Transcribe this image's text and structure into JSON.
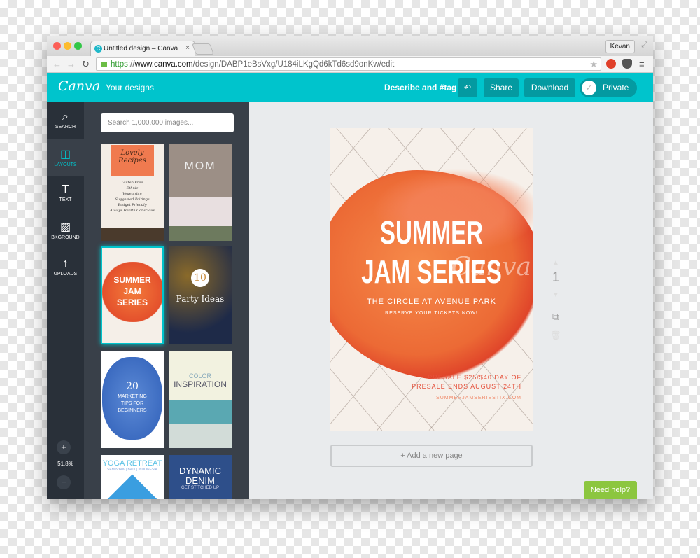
{
  "browser": {
    "tab_title": "Untitled design – Canva",
    "tab_favicon": "C",
    "close": "×",
    "user": "Kevan",
    "url": {
      "scheme": "https",
      "sep": "://",
      "host": "www.canva.com",
      "path": "/design/DABP1eBsVxg/U184iLKgQd6kTd6sd9onKw/edit"
    }
  },
  "header": {
    "logo": "Canva",
    "your_designs": "Your designs",
    "describe": "Describe and #tag",
    "share": "Share",
    "download": "Download",
    "private": "Private",
    "accent": "#00c4cc"
  },
  "rail": {
    "items": [
      {
        "label": "SEARCH",
        "icon": "search-icon"
      },
      {
        "label": "LAYOUTS",
        "icon": "layouts-icon"
      },
      {
        "label": "TEXT",
        "icon": "text-icon"
      },
      {
        "label": "BKGROUND",
        "icon": "background-icon"
      },
      {
        "label": "UPLOADS",
        "icon": "upload-icon"
      }
    ],
    "zoom": "51.8%",
    "plus": "+",
    "minus": "−"
  },
  "panel": {
    "search_placeholder": "Search 1,000,000 images...",
    "thumbs": [
      {
        "title": "Lovely Recipes",
        "lines": [
          "Gluten Free",
          "Ethnic",
          "Vegetarian",
          "Suggested Pairings",
          "Budget Friendly",
          "Always Health Conscious"
        ]
      },
      {
        "title": "MOM"
      },
      {
        "title": "SUMMER JAM SERIES"
      },
      {
        "num": "10",
        "title": "Party Ideas"
      },
      {
        "num": "20",
        "title": "MARKETING TIPS FOR BEGINNERS"
      },
      {
        "sub": "COLOR",
        "title": "INSPIRATION"
      },
      {
        "title": "YOGA RETREAT",
        "sub": "SEMINYAK | BALI | INDONESIA"
      },
      {
        "title": "DYNAMIC DENIM",
        "sub": "GET STITCHED UP"
      }
    ]
  },
  "design": {
    "title1": "SUMMER",
    "title2": "JAM SERIES",
    "watermark": "Canva",
    "venue": "THE CIRCLE AT AVENUE PARK",
    "reserve": "RESERVE YOUR TICKETS NOW!",
    "presale1": "PRESALE $25/$40 DAY OF",
    "presale2": "PRESALE ENDS AUGUST 24TH",
    "site": "SUMMERJAMSERIESTIX.COM",
    "page_number": "1"
  },
  "canvas": {
    "add_page": "+ Add a new page",
    "help": "Need help?"
  }
}
